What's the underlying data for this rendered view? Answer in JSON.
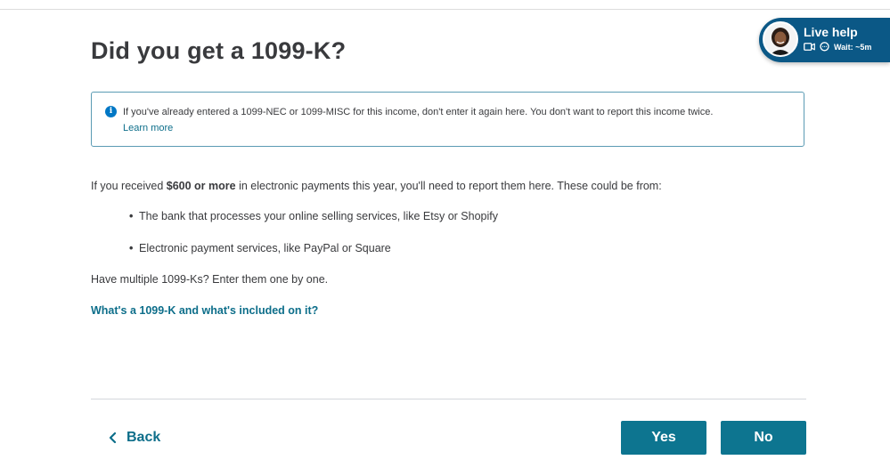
{
  "page": {
    "title": "Did you get a 1099-K?"
  },
  "info_box": {
    "icon": "info-icon",
    "text": "If you've already entered a 1099-NEC or 1099-MISC for this income, don't enter it again here. You don't want to report this income twice.",
    "link": "Learn more"
  },
  "body": {
    "intro_prefix": "If you received ",
    "intro_amount": "$600 or more",
    "intro_suffix": " in electronic payments this year, you'll need to report them here. These could be from:",
    "bullets": [
      "The bank that processes your online selling services, like Etsy or Shopify",
      "Electronic payment services, like PayPal or Square"
    ],
    "multiple_note": "Have multiple 1099-Ks? Enter them one by one.",
    "help_link": "What's a 1099-K and what's included on it?"
  },
  "footer": {
    "back_label": "Back",
    "yes_label": "Yes",
    "no_label": "No"
  },
  "live_help": {
    "title": "Live help",
    "wait_text": "Wait: ~5m",
    "icons": [
      "video-icon",
      "chat-icon"
    ]
  },
  "colors": {
    "accent": "#0d7590",
    "link": "#0d6e8a",
    "info_border": "#5b9bb4",
    "live_help_bg": "#0b5886"
  }
}
